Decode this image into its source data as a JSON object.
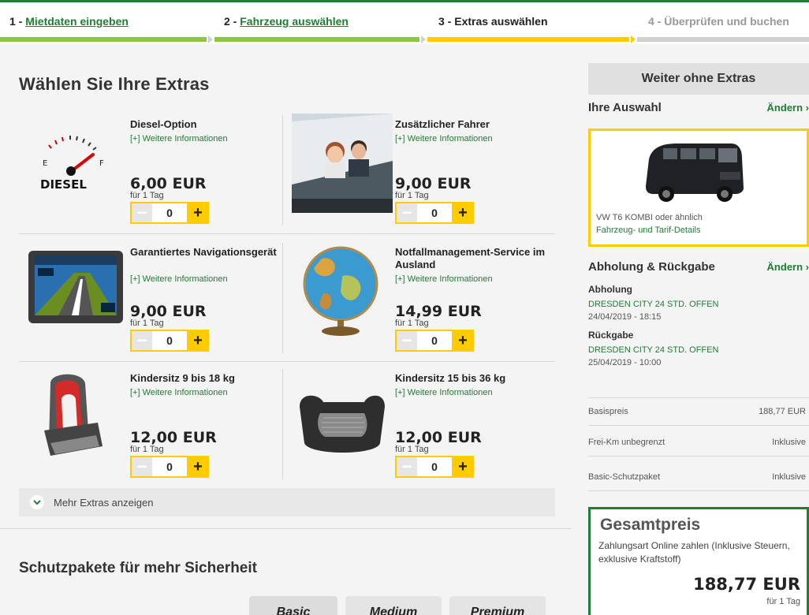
{
  "steps": [
    {
      "num": "1 - ",
      "label": "Mietdaten eingeben"
    },
    {
      "num": "2 - ",
      "label": "Fahrzeug auswählen"
    },
    {
      "label": "3 - Extras auswählen"
    },
    {
      "label": "4 - Überprüfen und buchen"
    }
  ],
  "colors": {
    "brand_green": "#1e7e34",
    "accent_yellow": "#ffcc00",
    "inactive": "#d0d0d0"
  },
  "main": {
    "title": "Wählen Sie Ihre Extras",
    "more_info": "[+] Weitere Informationen",
    "extras": [
      {
        "title": "Diesel-Option",
        "price": "6,00 EUR",
        "unit": "für 1 Tag",
        "qty": "0",
        "icon": "diesel-gauge-icon"
      },
      {
        "title": "Zusätzlicher Fahrer",
        "price": "9,00 EUR",
        "unit": "für 1 Tag",
        "qty": "0",
        "icon": "driver-photo"
      },
      {
        "title": "Garantiertes Navigationsgerät",
        "price": "9,00 EUR",
        "unit": "für 1 Tag",
        "qty": "0",
        "icon": "navigation-device-icon"
      },
      {
        "title": "Notfallmanagement-Service im Ausland",
        "price": "14,99 EUR",
        "unit": "für 1 Tag",
        "qty": "0",
        "icon": "globe-icon"
      },
      {
        "title": "Kindersitz 9 bis 18 kg",
        "price": "12,00 EUR",
        "unit": "für 1 Tag",
        "qty": "0",
        "icon": "child-seat-icon"
      },
      {
        "title": "Kindersitz 15 bis 36 kg",
        "price": "12,00 EUR",
        "unit": "für 1 Tag",
        "qty": "0",
        "icon": "booster-seat-icon"
      }
    ],
    "more_extras": "Mehr Extras anzeigen",
    "protection_title": "Schutzpakete für mehr Sicherheit",
    "packages": [
      "Basic",
      "Medium",
      "Premium"
    ]
  },
  "sidebar": {
    "skip_button": "Weiter ohne Extras",
    "selection_title": "Ihre Auswahl",
    "change_label": "Ändern",
    "vehicle_name": "VW T6 KOMBI oder ähnlich",
    "vehicle_details": "Fahrzeug- und Tarif-Details",
    "pickup_return_title": "Abholung & Rückgabe",
    "pickup_label": "Abholung",
    "pickup_location": "DRESDEN CITY 24 STD. OFFEN",
    "pickup_date": "24/04/2019 - 18:15",
    "return_label": "Rückgabe",
    "return_location": "DRESDEN CITY 24 STD. OFFEN",
    "return_date": "25/04/2019 - 10:00",
    "price_rows": [
      {
        "label": "Basispreis",
        "value": "188,77 EUR"
      },
      {
        "label": "Frei-Km  unbegrenzt",
        "value": "Inklusive"
      },
      {
        "label": "Basic-Schutzpaket",
        "value": "Inklusive"
      }
    ],
    "total_title": "Gesamtpreis",
    "total_note": "Zahlungsart Online zahlen (Inklusive Steuern, exklusive Kraftstoff)",
    "total_amount": "188,77 EUR",
    "total_unit": "für 1 Tag"
  }
}
